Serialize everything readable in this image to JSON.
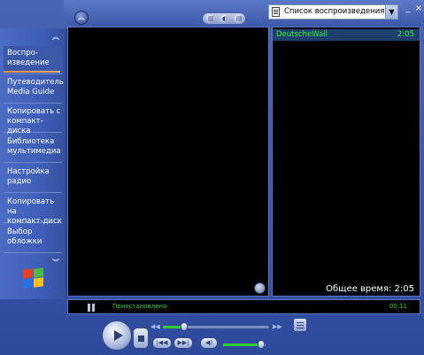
{
  "colors": {
    "shell": "#3a56a8",
    "pane_bg": "#000000",
    "text_green": "#33ee33",
    "selection": "#1f3f6f",
    "nav_accent": "#f08a3c"
  },
  "header": {
    "hide_menu_icon": "chevron-up-circle-icon",
    "pill_buttons": [
      {
        "name": "equalizer-icon",
        "glyph": "▥"
      },
      {
        "name": "visualization-icon",
        "glyph": "◐"
      },
      {
        "name": "playlist-view-icon",
        "glyph": "▤"
      }
    ],
    "playlist_select": {
      "value": "Список воспроизведения1",
      "icon": "playlist-document-icon"
    },
    "window_buttons": {
      "minimize": "_",
      "close": "×"
    }
  },
  "sidebar": {
    "scroll_up": "︽",
    "scroll_down": "︾",
    "items": [
      {
        "label": "Воспро-\nизведение",
        "name": "sidebar-item-now-playing",
        "active": true
      },
      {
        "label": "Путеводитель\nMedia Guide",
        "name": "sidebar-item-media-guide",
        "active": false
      },
      {
        "label": "Копировать с\nкомпакт-диска",
        "name": "sidebar-item-copy-from-cd",
        "active": false
      },
      {
        "label": "Библиотека\nмультимедиа",
        "name": "sidebar-item-media-library",
        "active": false
      },
      {
        "label": "Настройка\nрадио",
        "name": "sidebar-item-radio-tuner",
        "active": false
      },
      {
        "label": "Копировать на\nкомпакт-диск",
        "name": "sidebar-item-copy-to-cd",
        "active": false
      },
      {
        "label": "Выбор\nобложки",
        "name": "sidebar-item-skin-chooser",
        "active": false
      }
    ],
    "logo": "windows-logo"
  },
  "playlist": {
    "items": [
      {
        "title": "DeutscheWall",
        "duration": "2:05",
        "selected": true
      }
    ],
    "total_time": "Общее время: 2:05"
  },
  "status": {
    "message": "Приостановлено",
    "time": "00:11"
  },
  "transport": {
    "play": "play-icon",
    "stop": "stop-icon",
    "previous": "previous-track-icon",
    "next": "next-track-icon",
    "mute": "mute-icon",
    "seek_position": 0.2,
    "volume_level": 0.9
  }
}
